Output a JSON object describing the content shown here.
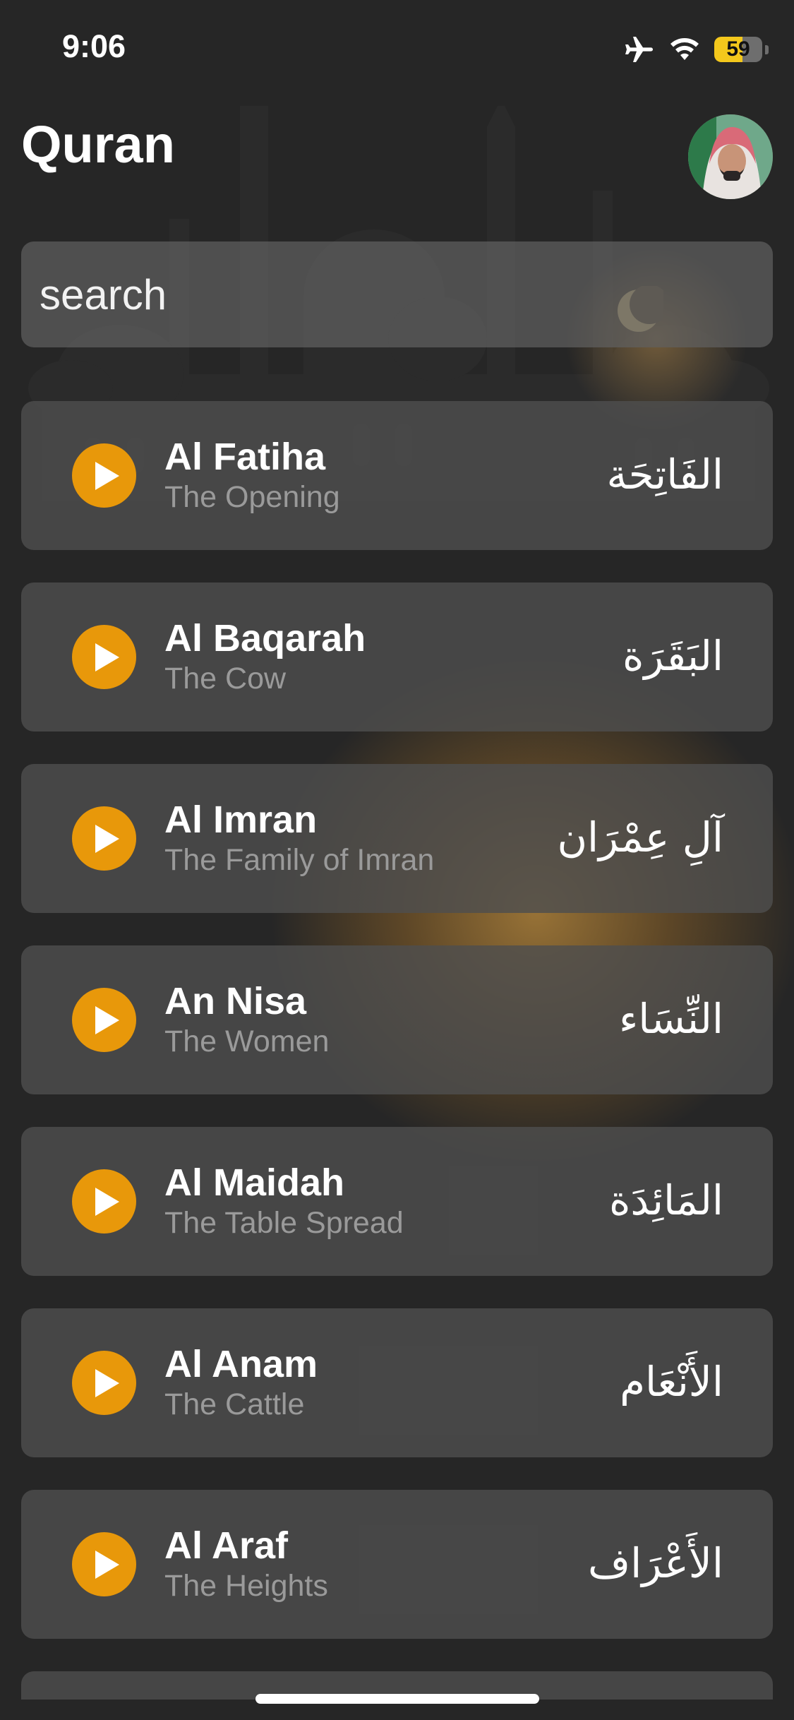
{
  "status_bar": {
    "time": "9:06",
    "battery": "59",
    "battery_level": 0.59,
    "icons": [
      "airplane-icon",
      "wifi-icon",
      "battery-icon"
    ]
  },
  "header": {
    "title": "Quran"
  },
  "search": {
    "placeholder": "search",
    "value": ""
  },
  "colors": {
    "accent": "#e8980a",
    "background": "#262626",
    "card": "#4e4e4e",
    "subtitle": "#9a9a9a"
  },
  "surahs": [
    {
      "name": "Al Fatiha",
      "meaning": "The Opening",
      "arabic": "الفَاتِحَة"
    },
    {
      "name": "Al Baqarah",
      "meaning": "The Cow",
      "arabic": "البَقَرَة"
    },
    {
      "name": "Al Imran",
      "meaning": "The Family of Imran",
      "arabic": "آلِ عِمْرَان"
    },
    {
      "name": "An Nisa",
      "meaning": "The Women",
      "arabic": "النِّسَاء"
    },
    {
      "name": "Al Maidah",
      "meaning": "The Table Spread",
      "arabic": "المَائِدَة"
    },
    {
      "name": "Al Anam",
      "meaning": "The Cattle",
      "arabic": "الأَنْعَام"
    },
    {
      "name": "Al Araf",
      "meaning": "The Heights",
      "arabic": "الأَعْرَاف"
    }
  ]
}
